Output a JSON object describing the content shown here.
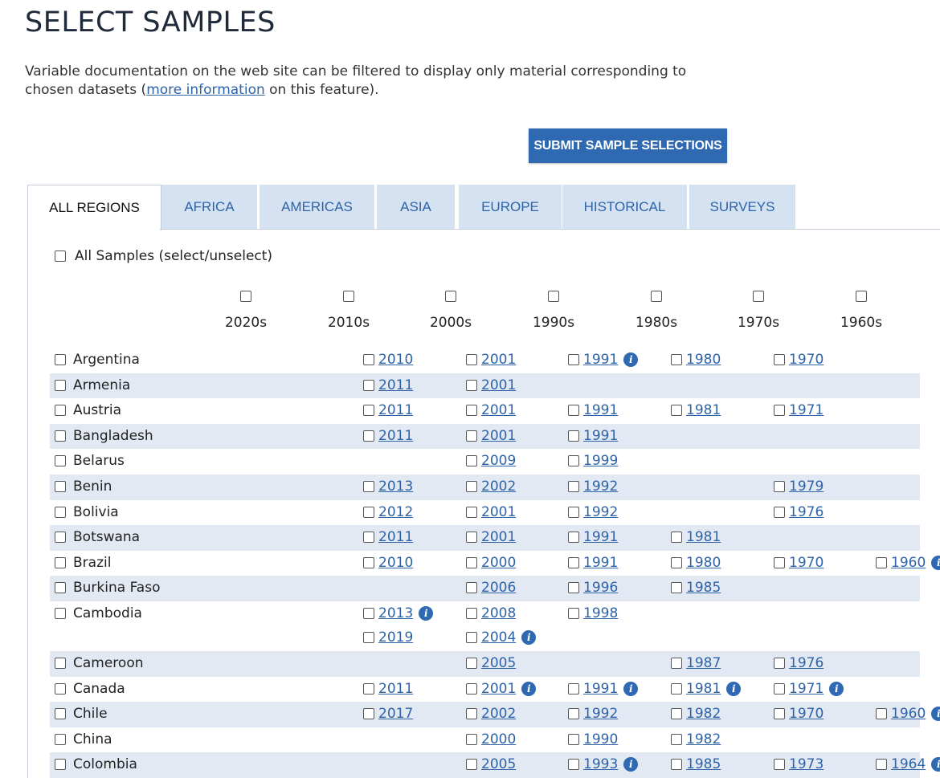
{
  "page": {
    "title": "SELECT SAMPLES",
    "intro_before": "Variable documentation on the web site can be filtered to display only material corresponding to chosen datasets (",
    "intro_link": "more information",
    "intro_after": " on this feature).",
    "submit_label": "SUBMIT SAMPLE SELECTIONS"
  },
  "tabs": [
    "ALL REGIONS",
    "AFRICA",
    "AMERICAS",
    "ASIA",
    "EUROPE",
    "HISTORICAL",
    "SURVEYS"
  ],
  "active_tab": "ALL REGIONS",
  "all_samples_label": "All Samples (select/unselect)",
  "decades": [
    "2020s",
    "2010s",
    "2000s",
    "1990s",
    "1980s",
    "1970s",
    "1960s"
  ],
  "rows": [
    {
      "country": "Argentina",
      "cells": {
        "2010s": [
          {
            "y": "2010"
          }
        ],
        "2000s": [
          {
            "y": "2001"
          }
        ],
        "1990s": [
          {
            "y": "1991",
            "i": true
          }
        ],
        "1980s": [
          {
            "y": "1980"
          }
        ],
        "1970s": [
          {
            "y": "1970"
          }
        ]
      }
    },
    {
      "country": "Armenia",
      "cells": {
        "2010s": [
          {
            "y": "2011"
          }
        ],
        "2000s": [
          {
            "y": "2001"
          }
        ]
      }
    },
    {
      "country": "Austria",
      "cells": {
        "2010s": [
          {
            "y": "2011"
          }
        ],
        "2000s": [
          {
            "y": "2001"
          }
        ],
        "1990s": [
          {
            "y": "1991"
          }
        ],
        "1980s": [
          {
            "y": "1981"
          }
        ],
        "1970s": [
          {
            "y": "1971"
          }
        ]
      }
    },
    {
      "country": "Bangladesh",
      "cells": {
        "2010s": [
          {
            "y": "2011"
          }
        ],
        "2000s": [
          {
            "y": "2001"
          }
        ],
        "1990s": [
          {
            "y": "1991"
          }
        ]
      }
    },
    {
      "country": "Belarus",
      "cells": {
        "2000s": [
          {
            "y": "2009"
          }
        ],
        "1990s": [
          {
            "y": "1999"
          }
        ]
      }
    },
    {
      "country": "Benin",
      "cells": {
        "2010s": [
          {
            "y": "2013"
          }
        ],
        "2000s": [
          {
            "y": "2002"
          }
        ],
        "1990s": [
          {
            "y": "1992"
          }
        ],
        "1970s": [
          {
            "y": "1979"
          }
        ]
      }
    },
    {
      "country": "Bolivia",
      "cells": {
        "2010s": [
          {
            "y": "2012"
          }
        ],
        "2000s": [
          {
            "y": "2001"
          }
        ],
        "1990s": [
          {
            "y": "1992"
          }
        ],
        "1970s": [
          {
            "y": "1976"
          }
        ]
      }
    },
    {
      "country": "Botswana",
      "cells": {
        "2010s": [
          {
            "y": "2011"
          }
        ],
        "2000s": [
          {
            "y": "2001"
          }
        ],
        "1990s": [
          {
            "y": "1991"
          }
        ],
        "1980s": [
          {
            "y": "1981"
          }
        ]
      }
    },
    {
      "country": "Brazil",
      "cells": {
        "2010s": [
          {
            "y": "2010"
          }
        ],
        "2000s": [
          {
            "y": "2000"
          }
        ],
        "1990s": [
          {
            "y": "1991"
          }
        ],
        "1980s": [
          {
            "y": "1980"
          }
        ],
        "1970s": [
          {
            "y": "1970"
          }
        ],
        "1960s": [
          {
            "y": "1960",
            "i": true
          }
        ]
      }
    },
    {
      "country": "Burkina Faso",
      "cells": {
        "2000s": [
          {
            "y": "2006"
          }
        ],
        "1990s": [
          {
            "y": "1996"
          }
        ],
        "1980s": [
          {
            "y": "1985"
          }
        ]
      }
    },
    {
      "country": "Cambodia",
      "cells": {
        "2010s": [
          {
            "y": "2013",
            "i": true
          },
          {
            "y": "2019"
          }
        ],
        "2000s": [
          {
            "y": "2008"
          },
          {
            "y": "2004",
            "i": true
          }
        ],
        "1990s": [
          {
            "y": "1998"
          }
        ]
      }
    },
    {
      "country": "Cameroon",
      "cells": {
        "2000s": [
          {
            "y": "2005"
          }
        ],
        "1980s": [
          {
            "y": "1987"
          }
        ],
        "1970s": [
          {
            "y": "1976"
          }
        ]
      }
    },
    {
      "country": "Canada",
      "cells": {
        "2010s": [
          {
            "y": "2011"
          }
        ],
        "2000s": [
          {
            "y": "2001",
            "i": true
          }
        ],
        "1990s": [
          {
            "y": "1991",
            "i": true
          }
        ],
        "1980s": [
          {
            "y": "1981",
            "i": true
          }
        ],
        "1970s": [
          {
            "y": "1971",
            "i": true
          }
        ]
      }
    },
    {
      "country": "Chile",
      "cells": {
        "2010s": [
          {
            "y": "2017"
          }
        ],
        "2000s": [
          {
            "y": "2002"
          }
        ],
        "1990s": [
          {
            "y": "1992"
          }
        ],
        "1980s": [
          {
            "y": "1982"
          }
        ],
        "1970s": [
          {
            "y": "1970"
          }
        ],
        "1960s": [
          {
            "y": "1960",
            "i": true
          }
        ]
      }
    },
    {
      "country": "China",
      "cells": {
        "2000s": [
          {
            "y": "2000"
          }
        ],
        "1990s": [
          {
            "y": "1990"
          }
        ],
        "1980s": [
          {
            "y": "1982"
          }
        ]
      }
    },
    {
      "country": "Colombia",
      "cells": {
        "2000s": [
          {
            "y": "2005"
          }
        ],
        "1990s": [
          {
            "y": "1993",
            "i": true
          }
        ],
        "1980s": [
          {
            "y": "1985"
          }
        ],
        "1970s": [
          {
            "y": "1973"
          }
        ],
        "1960s": [
          {
            "y": "1964",
            "i": true
          }
        ]
      }
    }
  ]
}
